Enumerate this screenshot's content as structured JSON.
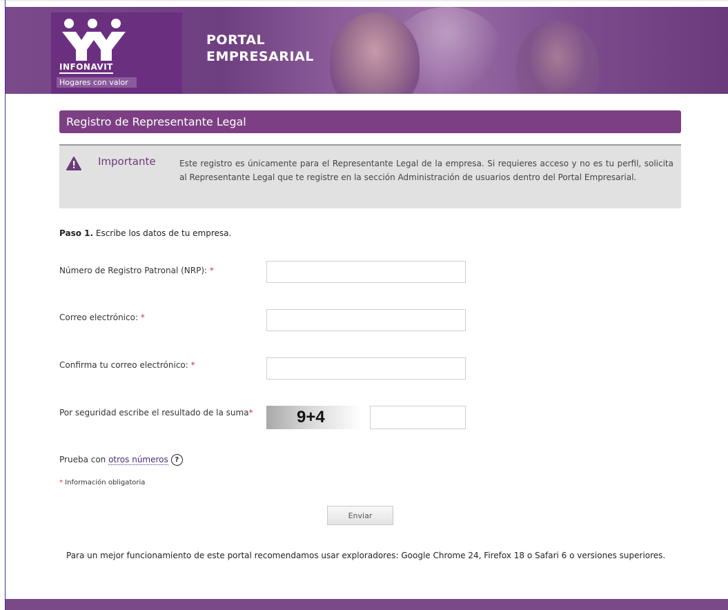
{
  "header": {
    "logo_word": "INFONAVIT",
    "logo_tagline": "Hogares con valor",
    "portal_line1": "PORTAL",
    "portal_line2": "EMPRESARIAL"
  },
  "section_title": "Registro de Representante Legal",
  "notice": {
    "title": "Importante",
    "text": "Este registro es únicamente para el Representante Legal de la empresa. Si requieres acceso y no es tu perfil, solicita al Representante Legal que te registre en la sección Administración de usuarios dentro del Portal Empresarial."
  },
  "step": {
    "prefix": "Paso 1.",
    "text": " Escribe los datos de tu empresa."
  },
  "fields": {
    "nrp_label": "Número de Registro Patronal (NRP):",
    "email_label": "Correo electrónico:",
    "confirm_email_label": "Confirma tu correo electrónico:",
    "captcha_label": "Por seguridad escribe el resultado de la suma",
    "required_mark": "*"
  },
  "captcha": {
    "expression": "9+4"
  },
  "retry": {
    "prefix": "Prueba con ",
    "link": "otros números",
    "help": "?"
  },
  "obligatory_note": {
    "mark": "*",
    "text": " Información obligatoria"
  },
  "submit_label": "Enviar",
  "browser_note": "Para un mejor funcionamiento de este portal recomendamos usar exploradores: Google Chrome 24, Firefox 18 o Safari 6 o versiones superiores.",
  "colors": {
    "brand_purple": "#7d3f84",
    "notice_bg": "#e1e1e1",
    "required_red": "#dd3333"
  }
}
